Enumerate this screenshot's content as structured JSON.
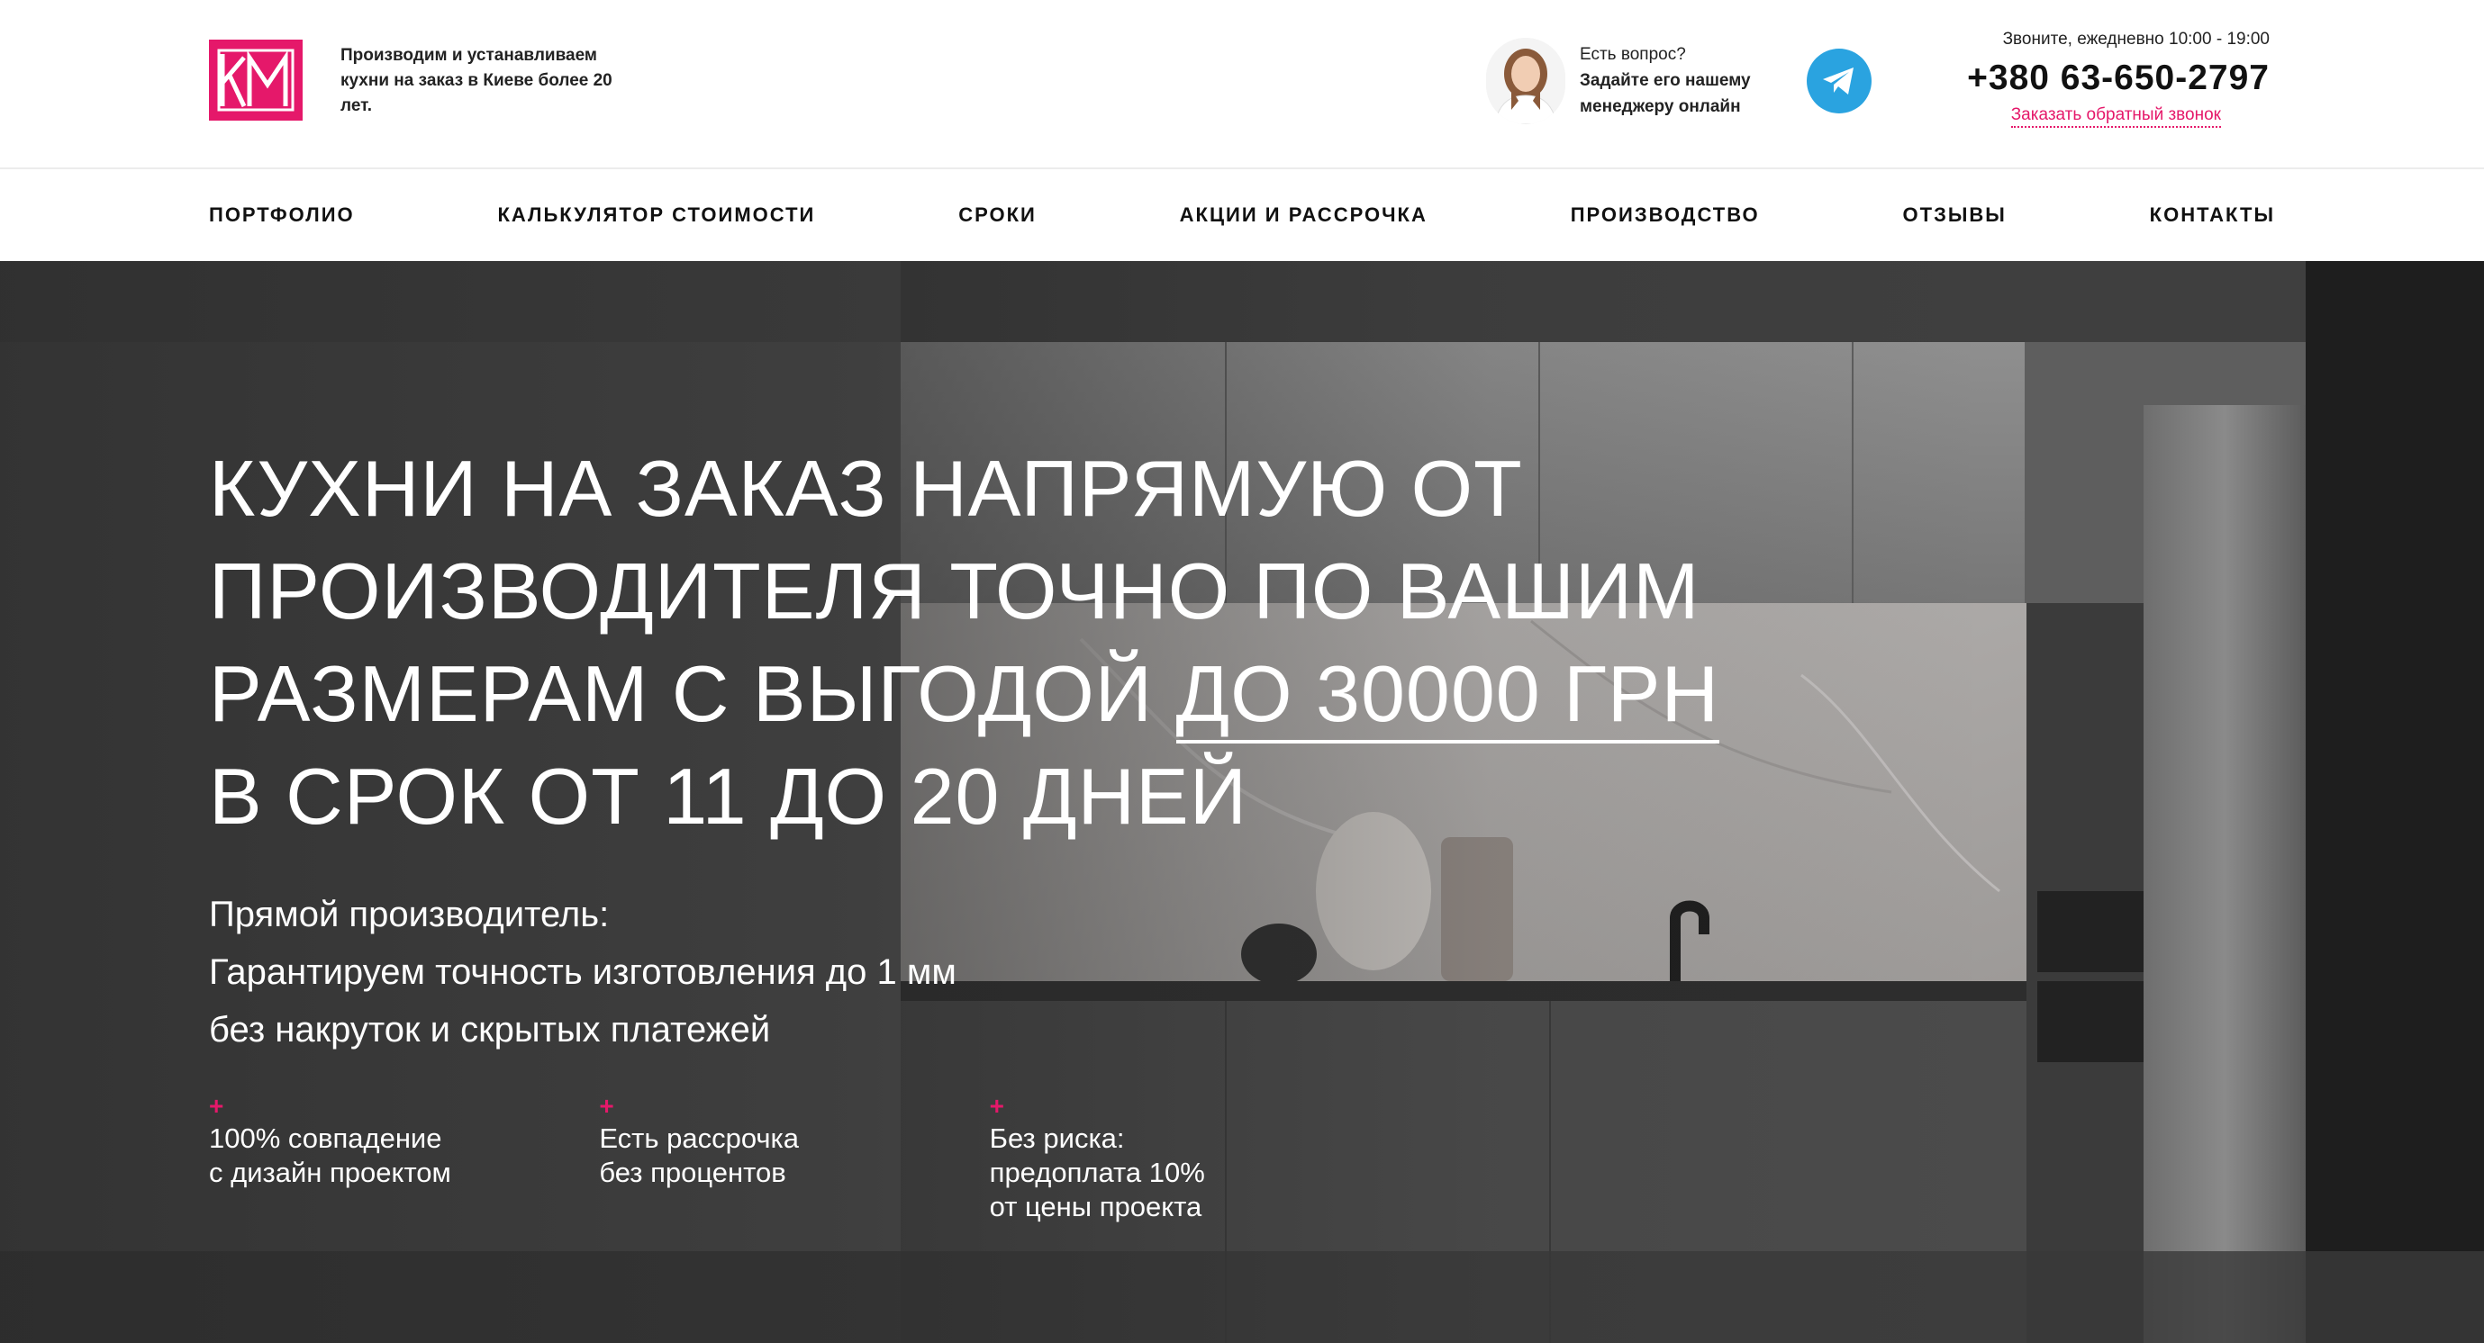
{
  "header": {
    "logo_text": "KM",
    "tagline": "Производим и устанавливаем кухни на заказ в Киеве более 20 лет.",
    "manager": {
      "question": "Есть вопрос?",
      "cta_line1": "Задайте его нашему",
      "cta_line2": "менеджеру онлайн"
    },
    "telegram_icon": "telegram-icon",
    "hours": "Звоните, ежедневно 10:00 - 19:00",
    "phone": "+380 63-650-2797",
    "callback_label": "Заказать обратный звонок"
  },
  "nav": {
    "items": [
      {
        "label": "ПОРТФОЛИО"
      },
      {
        "label": "КАЛЬКУЛЯТОР СТОИМОСТИ"
      },
      {
        "label": "СРОКИ"
      },
      {
        "label": "АКЦИИ И РАССРОЧКА"
      },
      {
        "label": "ПРОИЗВОДСТВО"
      },
      {
        "label": "ОТЗЫВЫ"
      },
      {
        "label": "КОНТАКТЫ"
      }
    ]
  },
  "hero": {
    "title_line1": "КУХНИ НА ЗАКАЗ НАПРЯМУЮ ОТ",
    "title_line2": "ПРОИЗВОДИТЕЛЯ ТОЧНО ПО ВАШИМ",
    "title_line3_prefix": "РАЗМЕРАМ С ВЫГОДОЙ ",
    "title_line3_accent": "ДО 30000 ГРН",
    "title_line4": "В СРОК ОТ 11 ДО 20 ДНЕЙ",
    "sub_line1": "Прямой производитель:",
    "sub_line2": "Гарантируем точность изготовления до 1 мм",
    "sub_line3": "без накруток и скрытых платежей",
    "features": [
      {
        "line1": "100% совпадение",
        "line2": "с дизайн проектом",
        "line3": ""
      },
      {
        "line1": "Есть рассрочка",
        "line2": "без процентов",
        "line3": ""
      },
      {
        "line1": "Без риска:",
        "line2": "предоплата 10%",
        "line3": "от цены проекта"
      }
    ],
    "plus_symbol": "+"
  },
  "colors": {
    "brand_pink": "#e5186a",
    "telegram_blue": "#2aa3e0"
  }
}
